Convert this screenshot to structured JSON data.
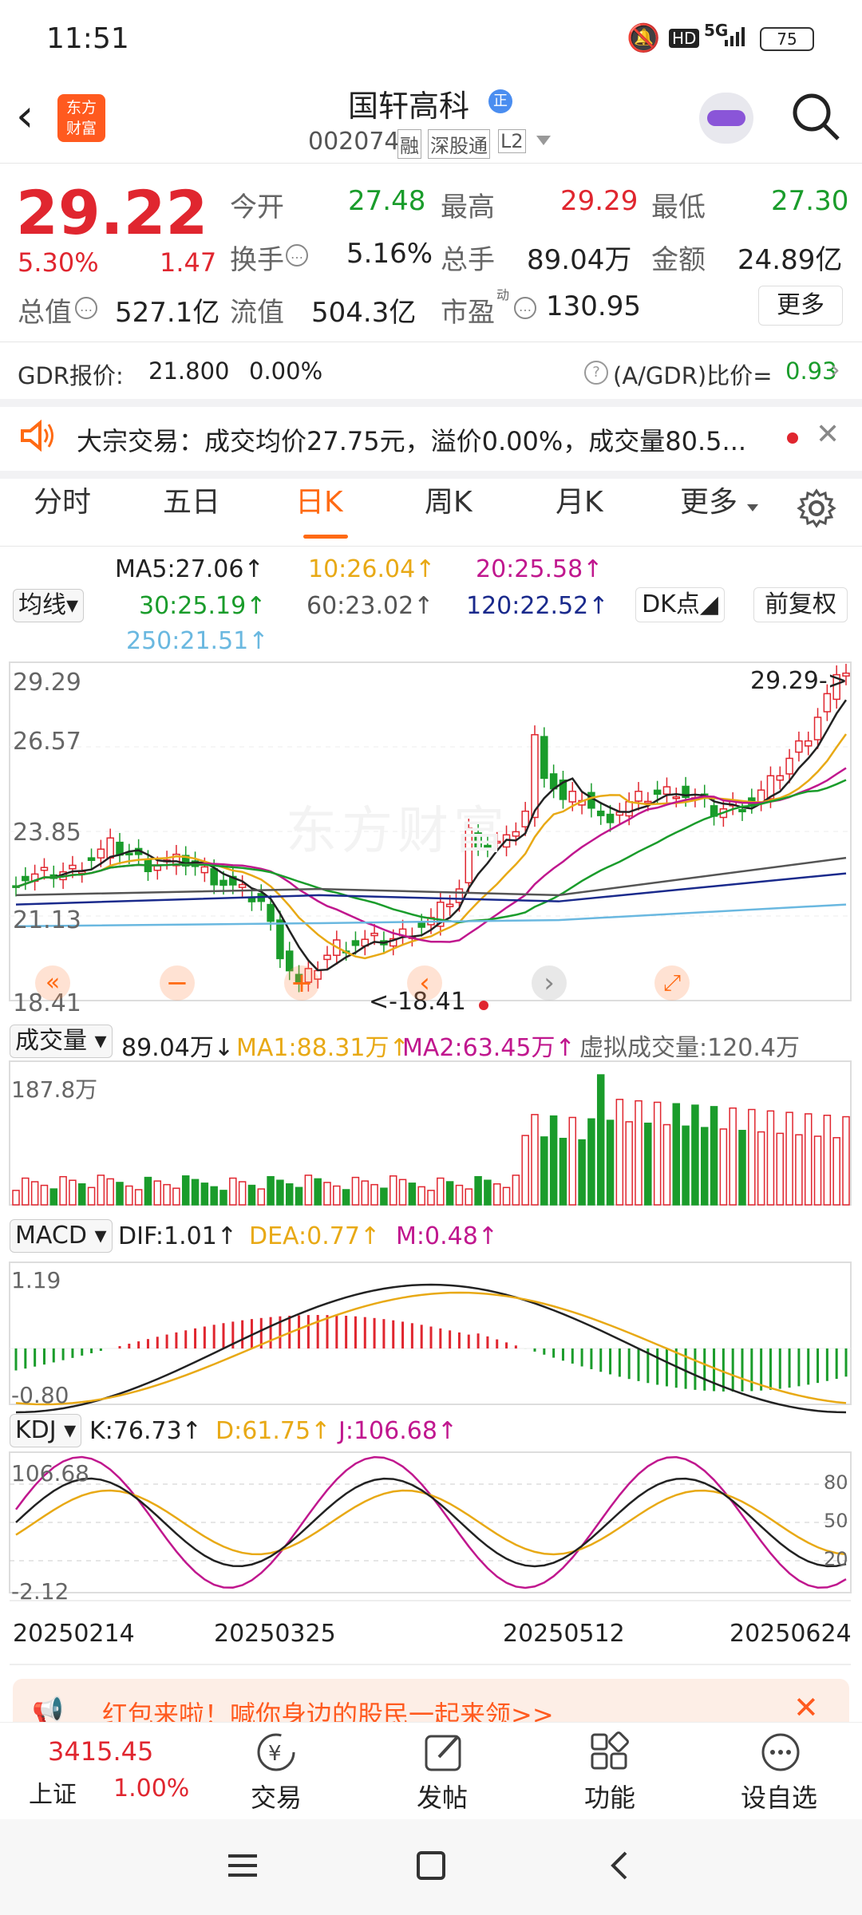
{
  "status_bar": {
    "time": "11:51",
    "network": "5G",
    "battery": "75"
  },
  "header": {
    "logo_line1": "东方",
    "logo_line2": "财富",
    "stock_name": "国轩高科",
    "badge": "正",
    "stock_code": "002074",
    "tags": [
      "融",
      "深股通",
      "L2"
    ]
  },
  "quote": {
    "price": "29.22",
    "change_pct": "5.30%",
    "change": "1.47",
    "open_label": "今开",
    "open": "27.48",
    "high_label": "最高",
    "high": "29.29",
    "low_label": "最低",
    "low": "27.30",
    "turnover_label": "换手",
    "turnover": "5.16%",
    "volume_label": "总手",
    "volume": "89.04万",
    "amount_label": "金额",
    "amount": "24.89亿",
    "mktcap_label": "总值",
    "mktcap": "527.1亿",
    "float_label": "流值",
    "float_cap": "504.3亿",
    "pe_label": "市盈",
    "pe_sup": "动",
    "pe": "130.95",
    "more_label": "更多"
  },
  "gdr": {
    "label": "GDR报价:",
    "price": "21.800",
    "pct": "0.00%",
    "ratio_label": "(A/GDR)比价=",
    "ratio": "0.93"
  },
  "notice": {
    "text": "大宗交易：成交均价27.75元，溢价0.00%，成交量80.5..."
  },
  "tabs": [
    {
      "label": "分时"
    },
    {
      "label": "五日"
    },
    {
      "label": "日K"
    },
    {
      "label": "周K"
    },
    {
      "label": "月K"
    },
    {
      "label": "更多"
    }
  ],
  "ma_bar": {
    "selector": "均线",
    "ma5": "MA5:27.06↑",
    "ma10": "10:26.04↑",
    "ma20": "20:25.58↑",
    "ma30": "30:25.19↑",
    "ma60": "60:23.02↑",
    "ma120": "120:22.52↑",
    "ma250": "250:21.51↑",
    "dk_button": "DK点",
    "adjust_button": "前复权"
  },
  "kline": {
    "y_labels": [
      "29.29",
      "26.57",
      "23.85",
      "21.13",
      "18.41"
    ],
    "max_marker": "29.29->",
    "min_marker": "<-18.41",
    "watermark": "东方财富"
  },
  "volume_bar": {
    "selector": "成交量",
    "vol": "89.04万↓",
    "ma1": "MA1:88.31万↑",
    "ma2": "MA2:63.45万↑",
    "virtual": "虚拟成交量:120.4万",
    "max": "187.8万"
  },
  "macd_bar": {
    "selector": "MACD",
    "dif": "DIF:1.01↑",
    "dea": "DEA:0.77↑",
    "m": "M:0.48↑",
    "top": "1.19",
    "bottom": "-0.80"
  },
  "kdj_bar": {
    "selector": "KDJ",
    "k": "K:76.73↑",
    "d": "D:61.75↑",
    "j": "J:106.68↑",
    "top": "106.68",
    "bottom": "-2.12",
    "mid1": "80",
    "mid2": "50",
    "mid3": "20"
  },
  "dates": [
    "20250214",
    "20250325",
    "20250512",
    "20250624"
  ],
  "banner": {
    "text": "红包来啦！喊你身边的股民一起来领>>"
  },
  "bottom_nav": {
    "index_value": "3415.45",
    "index_name": "上证",
    "index_pct": "1.00%",
    "items": [
      {
        "label": "交易"
      },
      {
        "label": "发帖"
      },
      {
        "label": "功能"
      },
      {
        "label": "设自选"
      }
    ]
  },
  "colors": {
    "up": "#e0262f",
    "down": "#1a9c2b",
    "accent": "#ff6a13"
  }
}
